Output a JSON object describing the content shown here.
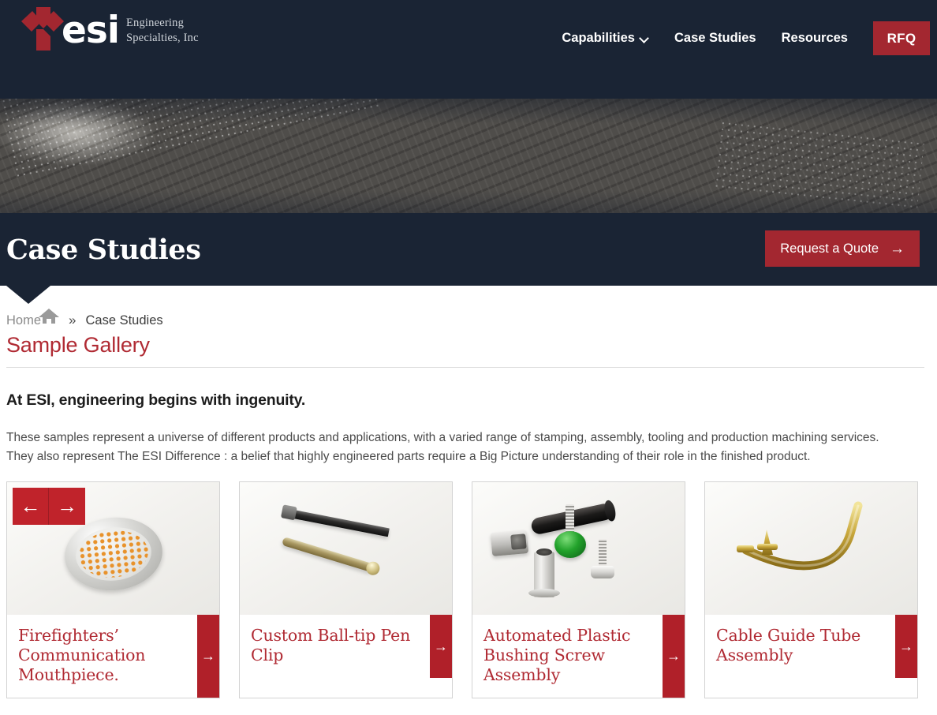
{
  "brand": {
    "logo_text": "esi",
    "logo_sub_line1": "Engineering",
    "logo_sub_line2": "Specialties, Inc",
    "accent_red": "#a32730",
    "bright_red": "#c0232b",
    "card_red": "#b02a33",
    "navy": "#1a2434"
  },
  "nav": {
    "items": [
      {
        "label": "Capabilities",
        "has_dropdown": true
      },
      {
        "label": "Case Studies",
        "has_dropdown": false
      },
      {
        "label": "Resources",
        "has_dropdown": false
      }
    ],
    "rfq_label": "RFQ"
  },
  "hero": {
    "title": "Case Studies",
    "quote_button": "Request a Quote",
    "quote_button_arrow": "→"
  },
  "breadcrumb": {
    "home_label": "Home",
    "home_icon": "home-icon",
    "separator": "»",
    "current": "Case Studies"
  },
  "content": {
    "section_heading": "Sample Gallery",
    "lede": "At ESI, engineering begins with ingenuity.",
    "paragraph_line1": "These samples represent a universe of different products and applications, with a varied range of stamping, assembly, tooling and production machining services.",
    "paragraph_line2": "They also represent The ESI Difference : a belief that highly engineered parts require a Big Picture understanding of their role in the finished product."
  },
  "carousel": {
    "prev_arrow": "←",
    "next_arrow": "→",
    "card_arrow": "→",
    "cards": [
      {
        "title": "Firefighters’ Communication Mouthpiece.",
        "image": "perforated-metal-disc-photo"
      },
      {
        "title": "Custom Ball-tip Pen Clip",
        "image": "pen-clips-photo"
      },
      {
        "title": "Automated Plastic Bushing Screw Assembly",
        "image": "bushing-screw-parts-photo"
      },
      {
        "title": "Cable Guide Tube Assembly",
        "image": "brass-cable-guide-tube-photo"
      }
    ]
  }
}
